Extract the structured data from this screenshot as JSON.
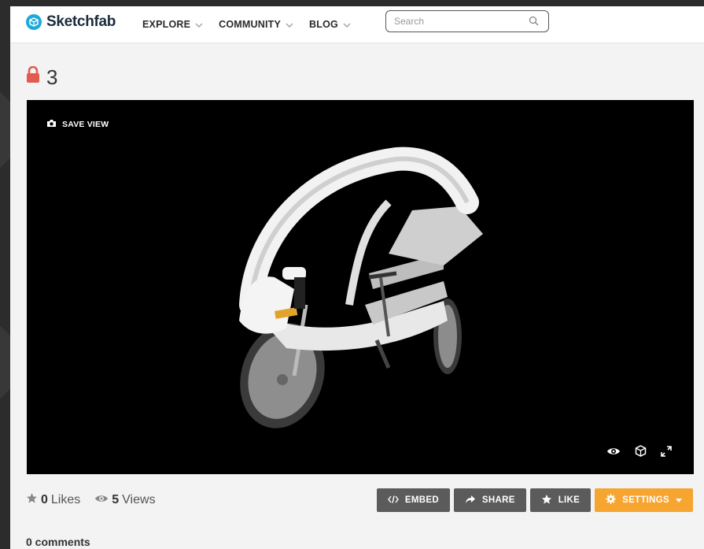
{
  "header": {
    "brand": "Sketchfab",
    "nav": [
      {
        "label": "EXPLORE"
      },
      {
        "label": "COMMUNITY"
      },
      {
        "label": "BLOG"
      }
    ],
    "search": {
      "placeholder": "Search",
      "value": ""
    }
  },
  "model": {
    "title": "3",
    "locked": true
  },
  "viewer": {
    "save_view_label": "SAVE VIEW",
    "controls": [
      "eye-icon",
      "cube-icon",
      "fullscreen-icon"
    ]
  },
  "stats": {
    "likes_count": "0",
    "likes_label": "Likes",
    "views_count": "5",
    "views_label": "Views"
  },
  "actions": {
    "embed": "EMBED",
    "share": "SHARE",
    "like": "LIKE",
    "settings": "SETTINGS"
  },
  "comments": {
    "label": "0 comments"
  },
  "colors": {
    "brand": "#1caad9",
    "lock": "#e25b4f",
    "settings": "#f7a531",
    "button_dark": "#5b5b5b"
  }
}
